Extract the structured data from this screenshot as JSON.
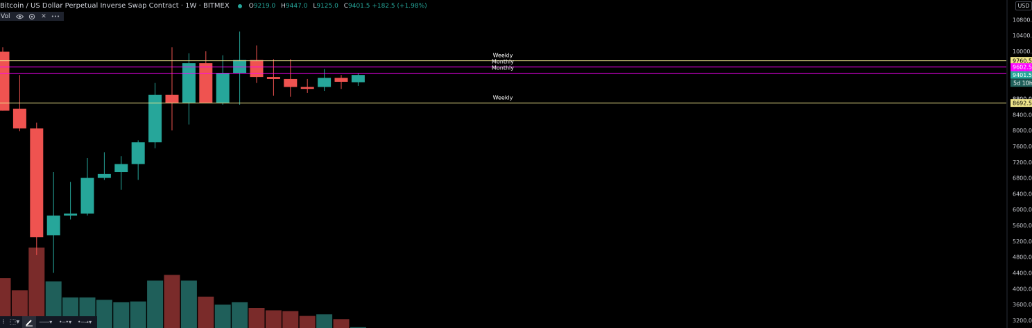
{
  "header": {
    "symbol": "Bitcoin / US Dollar Perpetual Inverse Swap Contract · 1W · BITMEX",
    "open_key": "O",
    "open": "9219.0",
    "high_key": "H",
    "high": "9447.0",
    "low_key": "L",
    "low": "9125.0",
    "close_key": "C",
    "close": "9401.5 +182.5 (+1.98%)"
  },
  "indicator": {
    "label": "Vol",
    "eye_icon": "eye-icon",
    "settings_icon": "settings-icon",
    "close_icon": "close-icon",
    "more_icon": "more-icon",
    "close_glyph": "✕",
    "more_glyph": "•••"
  },
  "currency": "USD",
  "toolbar": {
    "grid_glyph": "⁝",
    "select_glyph": "⬚▾",
    "line_glyph": "───▾",
    "ray_glyph": "•─•▾",
    "arrow_glyph": "•─→▾"
  },
  "colors": {
    "up": "#26a69a",
    "down": "#ef5350",
    "up_vol": "#1f5f5a",
    "down_vol": "#7a2b2a",
    "weekly": "#f0e68c",
    "monthly": "#ff00ff"
  },
  "chart_data": {
    "type": "candlestick",
    "timeframe": "1W",
    "ylim": [
      3050,
      10800
    ],
    "y_ticks": [
      "10800.0",
      "10400.0",
      "10000.0",
      "9600.0",
      "9200.0",
      "8800.0",
      "8400.0",
      "8000.0",
      "7600.0",
      "7200.0",
      "6800.0",
      "6400.0",
      "6000.0",
      "5600.0",
      "5200.0",
      "4800.0",
      "4400.0",
      "4000.0",
      "3600.0",
      "3200.0"
    ],
    "candles": [
      {
        "o": 9990,
        "h": 10100,
        "l": 8500,
        "c": 8500
      },
      {
        "o": 8550,
        "h": 9400,
        "l": 7980,
        "c": 8050
      },
      {
        "o": 8050,
        "h": 8200,
        "l": 4850,
        "c": 5300
      },
      {
        "o": 5350,
        "h": 6950,
        "l": 4400,
        "c": 5850
      },
      {
        "o": 5850,
        "h": 6700,
        "l": 5750,
        "c": 5900
      },
      {
        "o": 5900,
        "h": 7300,
        "l": 5850,
        "c": 6800
      },
      {
        "o": 6800,
        "h": 7450,
        "l": 6750,
        "c": 6900
      },
      {
        "o": 6950,
        "h": 7350,
        "l": 6500,
        "c": 7150
      },
      {
        "o": 7150,
        "h": 7750,
        "l": 6750,
        "c": 7700
      },
      {
        "o": 7700,
        "h": 9200,
        "l": 7550,
        "c": 8900
      },
      {
        "o": 8900,
        "h": 10100,
        "l": 8000,
        "c": 8700
      },
      {
        "o": 8700,
        "h": 9950,
        "l": 8150,
        "c": 9700
      },
      {
        "o": 9700,
        "h": 10000,
        "l": 8700,
        "c": 8700
      },
      {
        "o": 8700,
        "h": 9900,
        "l": 8650,
        "c": 9450
      },
      {
        "o": 9450,
        "h": 10500,
        "l": 8650,
        "c": 9780
      },
      {
        "o": 9780,
        "h": 10150,
        "l": 9200,
        "c": 9350
      },
      {
        "o": 9350,
        "h": 9800,
        "l": 8880,
        "c": 9300
      },
      {
        "o": 9300,
        "h": 9800,
        "l": 8850,
        "c": 9100
      },
      {
        "o": 9100,
        "h": 9300,
        "l": 8950,
        "c": 9050
      },
      {
        "o": 9100,
        "h": 9550,
        "l": 9000,
        "c": 9330
      },
      {
        "o": 9330,
        "h": 9400,
        "l": 9050,
        "c": 9230
      },
      {
        "o": 9219,
        "h": 9447,
        "l": 9125,
        "c": 9401.5
      }
    ],
    "volume": [
      62,
      47,
      100,
      58,
      38,
      38,
      35,
      32,
      33,
      59,
      66,
      59,
      39,
      29,
      32,
      25,
      22,
      21,
      15,
      17,
      11,
      1
    ],
    "levels": [
      {
        "label": "Weekly",
        "price": 9760.5,
        "price_label": "9760.5",
        "kind": "weekly"
      },
      {
        "label": "Monthly",
        "price": 9602.5,
        "price_label": "9602.5",
        "kind": "monthly"
      },
      {
        "label": "Monthly",
        "price": 9445.5,
        "price_label": "9445.5",
        "kind": "monthly"
      },
      {
        "label": "Weekly",
        "price": 8692.5,
        "price_label": "8692.5",
        "kind": "weekly"
      }
    ],
    "last_price": {
      "label": "9401.5",
      "countdown": "5d 10h"
    },
    "partial_tick": "8800.0"
  }
}
